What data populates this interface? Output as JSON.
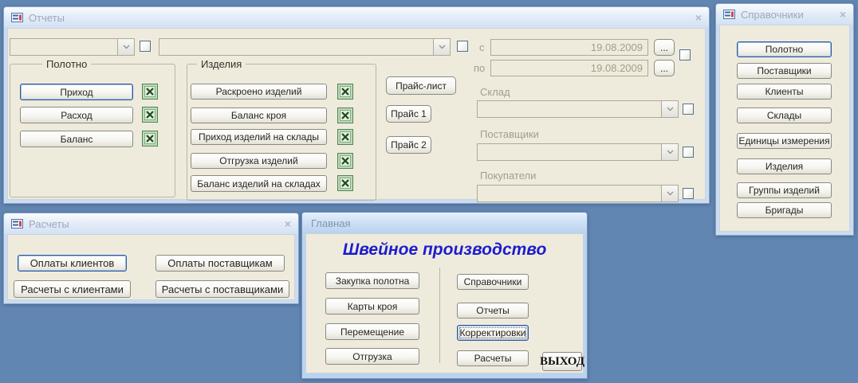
{
  "icons": {
    "close": "×"
  },
  "colors": {
    "desktop": "#6286B2",
    "window_frame": "#CBDCF1",
    "window_body": "#EFEBDC",
    "focus_border": "#2C5AA0",
    "heading_blue": "#1C1CCE",
    "excel_green": "#2F6832",
    "disabled_text": "#A19E8C"
  },
  "reports": {
    "title": "Отчеты",
    "fabric_group": {
      "label": "Полотно",
      "buttons": [
        "Приход",
        "Расход",
        "Баланс"
      ]
    },
    "products_group": {
      "label": "Изделия",
      "buttons": [
        "Раскроено изделий",
        "Баланс кроя",
        "Приход изделий на склады",
        "Отгрузка изделий",
        "Баланс изделий на складах"
      ]
    },
    "price_buttons": [
      "Прайс-лист",
      "Прайс 1",
      "Прайс 2"
    ],
    "period": {
      "from_label": "с",
      "from_value": "19.08.2009",
      "to_label": "по",
      "to_value": "19.08.2009",
      "picker_label": "..."
    },
    "filters": [
      {
        "label": "Склад"
      },
      {
        "label": "Поставщики"
      },
      {
        "label": "Покупатели"
      }
    ]
  },
  "references": {
    "title": "Справочники",
    "buttons": [
      "Полотно",
      "Поставщики",
      "Клиенты",
      "Склады",
      "Единицы измерения",
      "Изделия",
      "Группы изделий",
      "Бригады"
    ]
  },
  "calculations": {
    "title": "Расчеты",
    "buttons": [
      "Оплаты клиентов",
      "Оплаты поставщикам",
      "Расчеты с клиентами",
      "Расчеты с поставщиками"
    ]
  },
  "main": {
    "title": "Главная",
    "heading": "Швейное производство",
    "operation_buttons": [
      "Закупка полотна",
      "Карты кроя",
      "Перемещение",
      "Отгрузка"
    ],
    "section_buttons": [
      "Справочники",
      "Отчеты",
      "Корректировки",
      "Расчеты"
    ],
    "exit_label": "ВЫХОД"
  }
}
